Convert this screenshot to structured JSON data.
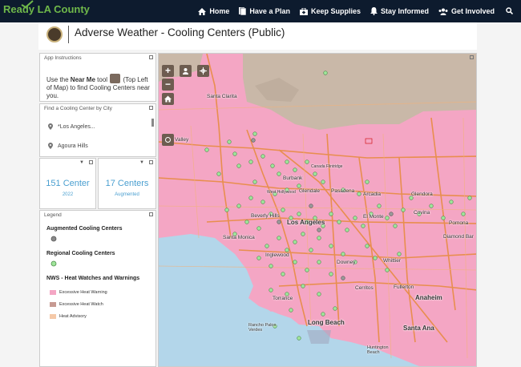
{
  "nav": {
    "logo_ready": "Ready",
    "logo_la": "LA County",
    "items": [
      {
        "label": "Home",
        "icon": "home-icon"
      },
      {
        "label": "Have a Plan",
        "icon": "document-icon"
      },
      {
        "label": "Keep Supplies",
        "icon": "kit-icon"
      },
      {
        "label": "Stay Informed",
        "icon": "bell-icon"
      },
      {
        "label": "Get Involved",
        "icon": "people-icon"
      }
    ]
  },
  "header": {
    "title": "Adverse Weather - Cooling Centers (Public)"
  },
  "instructions": {
    "title": "App Instructions",
    "text_pre": "Use the ",
    "text_bold": "Near Me",
    "text_mid": " tool ",
    "text_post": " (Top Left of Map) to find Cooling Centers near you."
  },
  "city_finder": {
    "title": "Find a Cooling Center by City",
    "cities": [
      "*Los Angeles...",
      "Agoura Hills"
    ]
  },
  "stats": [
    {
      "value": "151 Center",
      "label": "2022"
    },
    {
      "value": "17 Centers",
      "label": "Augmented"
    }
  ],
  "legend": {
    "title": "Legend",
    "sections": [
      {
        "heading": "Augmented Cooling Centers"
      },
      {
        "heading": "Regional Cooling Centers"
      },
      {
        "heading": "NWS - Heat Watches and Warnings"
      }
    ],
    "nws_items": [
      "Excessive Heat Warning",
      "Excessive Heat Watch",
      "Heat Advisory"
    ]
  },
  "map": {
    "labels": {
      "santa_clarita": "Santa Clarita",
      "valley": "Valley",
      "burbank": "Burbank",
      "canada": "Canada Flintridge",
      "glendale": "Glendale",
      "pasadena": "Pasadena",
      "arcadia": "Arcadia",
      "glendora": "Glendora",
      "beverly_hills": "Beverly Hills",
      "west_hollywood": "West Hollywood",
      "los_angeles": "Los Angeles",
      "el_monte": "El Monte",
      "covina": "Covina",
      "pomona": "Pomona",
      "santa_monica": "Santa Monica",
      "diamond_bar": "Diamond Bar",
      "inglewood": "Inglewood",
      "downey": "Downey",
      "whittier": "Whittier",
      "cerritos": "Cerritos",
      "fullerton": "Fullerton",
      "torrance": "Torrance",
      "anaheim": "Anaheim",
      "long_beach": "Long Beach",
      "santa_ana": "Santa Ana",
      "rancho_palos_verdes": "Rancho Palos Verdes",
      "huntington_beach": "Huntington Beach"
    },
    "colors": {
      "pink": "#f4a6c4",
      "brown": "#c9b8a8",
      "water": "#b3d6ea",
      "center_green": "#9fe59a"
    }
  }
}
